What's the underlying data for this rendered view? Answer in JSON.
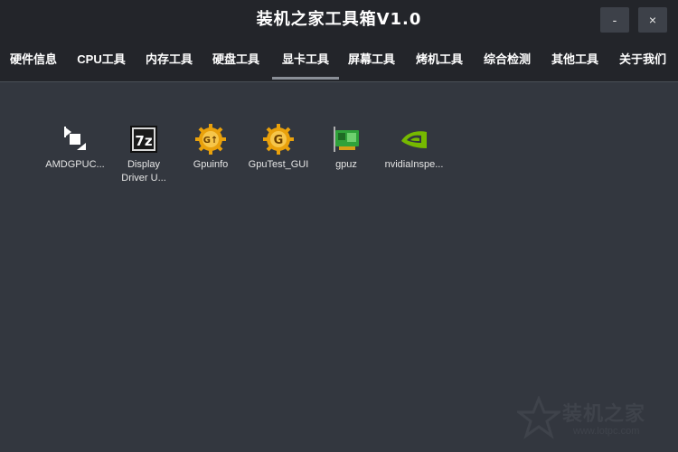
{
  "window": {
    "title": "装机之家工具箱V1.0",
    "minimize_label": "-",
    "close_label": "×"
  },
  "tabs": [
    {
      "label": "硬件信息"
    },
    {
      "label": "CPU工具"
    },
    {
      "label": "内存工具"
    },
    {
      "label": "硬盘工具"
    },
    {
      "label": "显卡工具",
      "active": true
    },
    {
      "label": "屏幕工具"
    },
    {
      "label": "烤机工具"
    },
    {
      "label": "综合检测"
    },
    {
      "label": "其他工具"
    },
    {
      "label": "关于我们"
    }
  ],
  "tools": [
    {
      "label": "AMDGPUC...",
      "icon": "amd-gpu-clock-icon"
    },
    {
      "label": "Display\nDriver U...",
      "icon": "7zip-archive-icon"
    },
    {
      "label": "Gpuinfo",
      "icon": "gpuinfo-gear-icon"
    },
    {
      "label": "GpuTest_GUI",
      "icon": "gputest-gear-icon"
    },
    {
      "label": "gpuz",
      "icon": "graphics-card-icon"
    },
    {
      "label": "nvidiaInspe...",
      "icon": "nvidia-logo-icon"
    }
  ],
  "watermark": {
    "text": "装机之家",
    "url": "www.lotpc.com"
  },
  "colors": {
    "titlebar_bg": "#23252a",
    "content_bg": "#33373f",
    "active_tab_underline": "#8a8f97",
    "text": "#ffffff"
  }
}
